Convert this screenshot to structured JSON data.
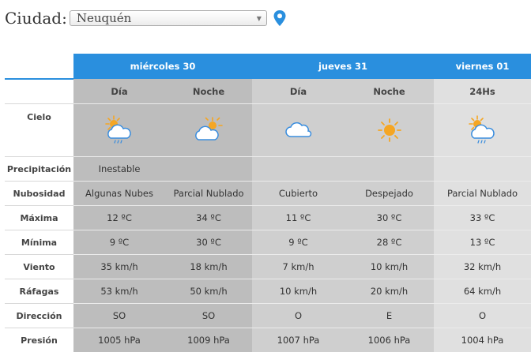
{
  "city": {
    "label": "Ciudad:",
    "value": "Neuquén"
  },
  "icons": {
    "location": "location-pin-icon",
    "dropdown": "chevron-down-icon"
  },
  "colors": {
    "header_blue": "#2a8fde",
    "sun": "#f5a623",
    "cloud": "#3a8dde"
  },
  "days": [
    {
      "name": "miércoles 30",
      "periods": [
        "Día",
        "Noche"
      ]
    },
    {
      "name": "jueves 31",
      "periods": [
        "Día",
        "Noche"
      ]
    },
    {
      "name": "viernes 01",
      "periods": [
        "24Hs"
      ]
    }
  ],
  "rows": {
    "cielo": {
      "label": "Cielo",
      "icons": [
        "sun-cloud-rain-icon",
        "cloud-sun-icon",
        "cloud-icon",
        "sun-icon",
        "sun-cloud-rain-icon"
      ]
    },
    "precipitacion": {
      "label": "Precipitación",
      "values": [
        "Inestable",
        "",
        "",
        "",
        ""
      ]
    },
    "nubosidad": {
      "label": "Nubosidad",
      "values": [
        "Algunas Nubes",
        "Parcial Nublado",
        "Cubierto",
        "Despejado",
        "Parcial Nublado"
      ]
    },
    "maxima": {
      "label": "Máxima",
      "values": [
        "12 ºC",
        "34 ºC",
        "11 ºC",
        "30 ºC",
        "33 ºC"
      ]
    },
    "minima": {
      "label": "Mínima",
      "values": [
        "9 ºC",
        "30 ºC",
        "9 ºC",
        "28 ºC",
        "13 ºC"
      ]
    },
    "viento": {
      "label": "Viento",
      "values": [
        "35 km/h",
        "18 km/h",
        "7 km/h",
        "10 km/h",
        "32 km/h"
      ]
    },
    "rafagas": {
      "label": "Ráfagas",
      "values": [
        "53 km/h",
        "50 km/h",
        "10 km/h",
        "20 km/h",
        "64 km/h"
      ]
    },
    "direccion": {
      "label": "Dirección",
      "values": [
        "SO",
        "SO",
        "O",
        "E",
        "O"
      ]
    },
    "presion": {
      "label": "Presión",
      "values": [
        "1005 hPa",
        "1009 hPa",
        "1007 hPa",
        "1006 hPa",
        "1004 hPa"
      ]
    }
  }
}
